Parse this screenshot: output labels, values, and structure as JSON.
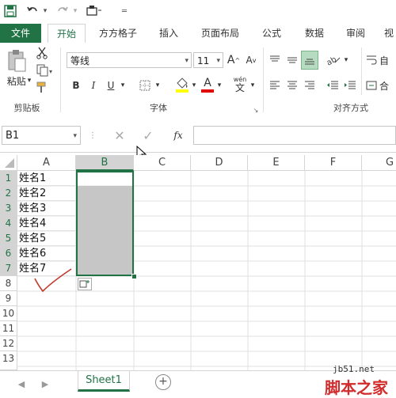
{
  "qat": {
    "save": "save-icon",
    "undo": "undo-icon",
    "redo": "redo-icon",
    "customize": "customize-icon"
  },
  "tabs": [
    "文件",
    "开始",
    "方方格子",
    "插入",
    "页面布局",
    "公式",
    "数据",
    "审阅",
    "视"
  ],
  "ribbon": {
    "paste_label": "粘贴",
    "clipboard_group": "剪贴板",
    "font_name": "等线",
    "font_size": "11",
    "font_group": "字体",
    "align_group": "对齐方式",
    "bold": "B",
    "italic": "I",
    "underline": "U",
    "grow_font": "A",
    "shrink_font": "A",
    "font_color": "A",
    "wen": "wén",
    "wen_sub": "文",
    "wrap_label": "自",
    "merge_label": "合"
  },
  "formula_bar": {
    "name_box": "B1",
    "fx": "fx",
    "formula": ""
  },
  "columns": [
    "A",
    "B",
    "C",
    "D",
    "E",
    "F",
    "G"
  ],
  "rows": [
    "1",
    "2",
    "3",
    "4",
    "5",
    "6",
    "7",
    "8",
    "9",
    "10",
    "11",
    "12",
    "13"
  ],
  "cells_A": [
    "姓名1",
    "姓名2",
    "姓名3",
    "姓名4",
    "姓名5",
    "姓名6",
    "姓名7"
  ],
  "sheet_tabs": [
    "Sheet1"
  ],
  "watermark": {
    "site": "jb51.net",
    "name": "脚本之家"
  },
  "colors": {
    "excel_green": "#217346",
    "selection_fill": "#c6c6c6"
  }
}
